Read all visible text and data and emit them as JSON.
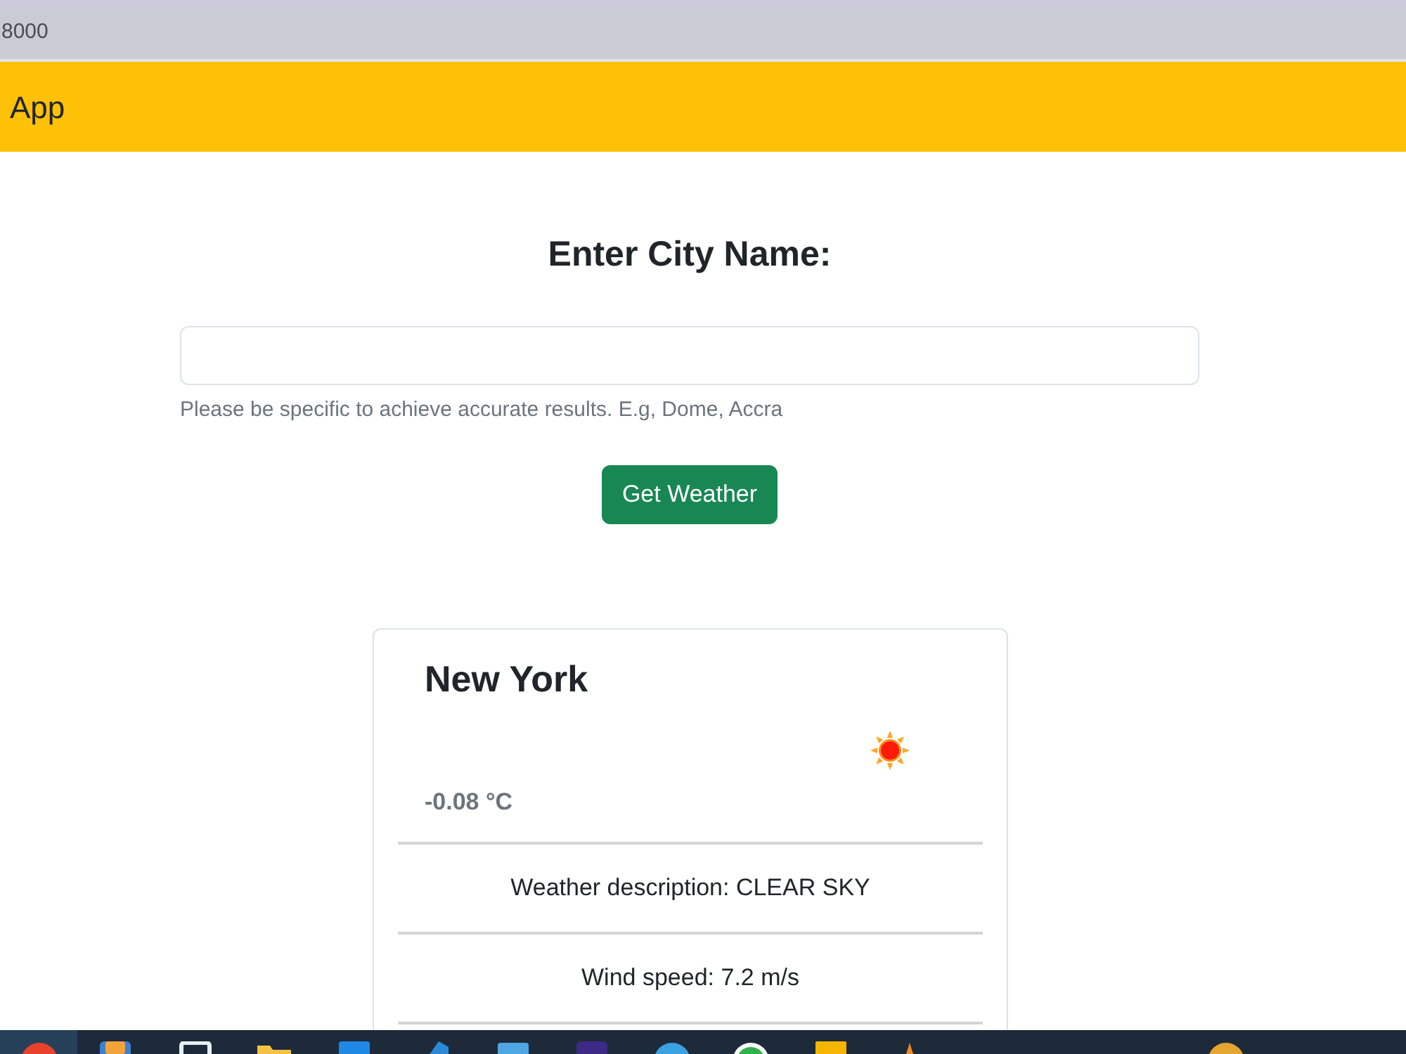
{
  "browser": {
    "address": "8000"
  },
  "navbar": {
    "brand": "App"
  },
  "search_form": {
    "heading": "Enter City Name:",
    "help_text": "Please be specific to achieve accurate results. E.g, Dome, Accra",
    "button": "Get Weather"
  },
  "weather_card": {
    "city": "New York",
    "temperature": "-0.08 °C",
    "details": [
      "Weather description: CLEAR SKY",
      "Wind speed: 7.2 m/s"
    ]
  }
}
